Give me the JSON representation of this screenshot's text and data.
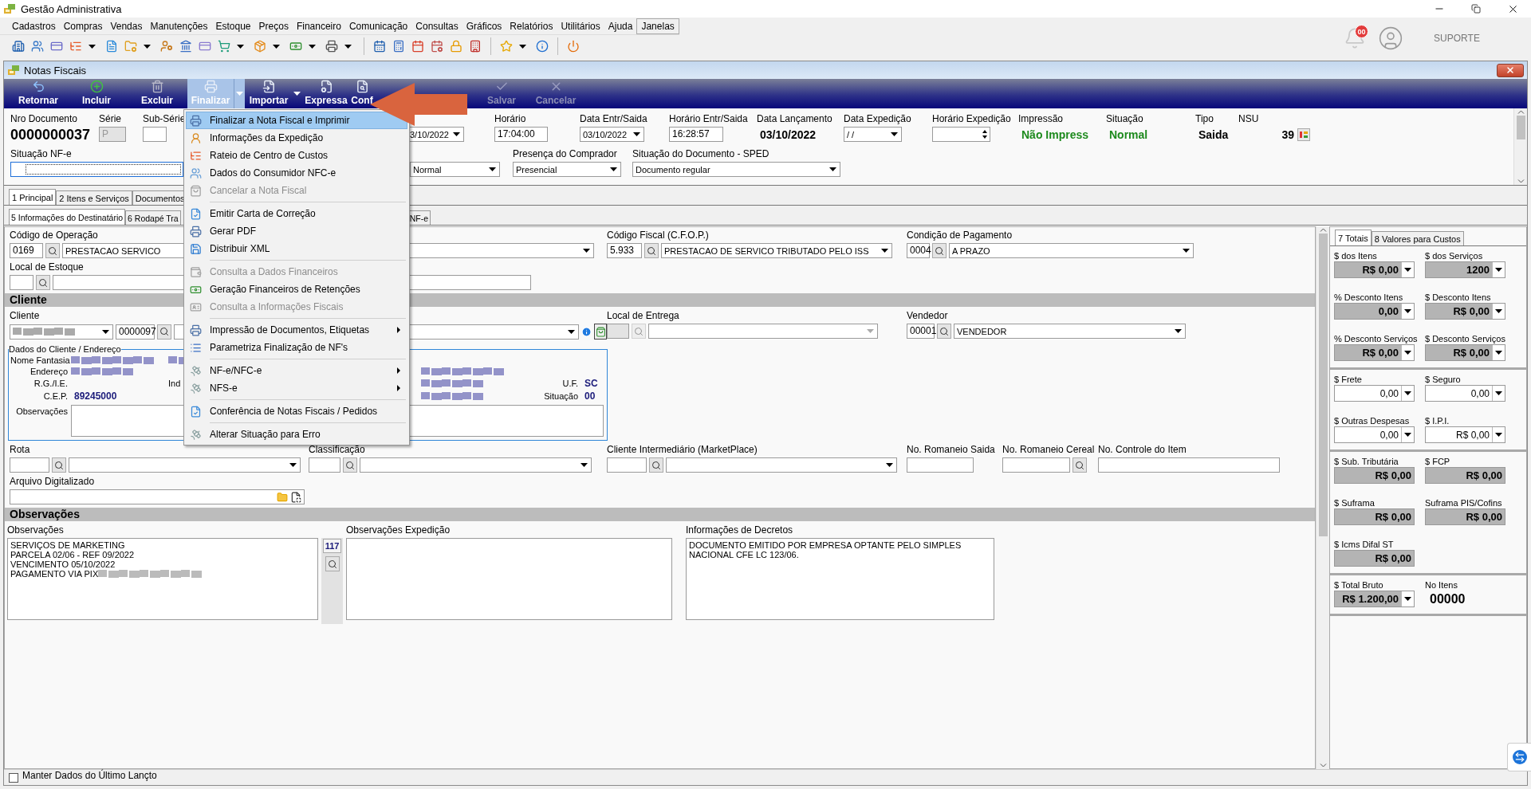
{
  "app": {
    "title": "Gestão Administrativa",
    "menu": [
      {
        "label": "Cadastros",
        "selected": false
      },
      {
        "label": "Compras",
        "selected": false
      },
      {
        "label": "Vendas",
        "selected": false
      },
      {
        "label": "Manutenções",
        "selected": false
      },
      {
        "label": "Estoque",
        "selected": false
      },
      {
        "label": "Preços",
        "selected": false
      },
      {
        "label": "Financeiro",
        "selected": false
      },
      {
        "label": "Comunicação",
        "selected": false
      },
      {
        "label": "Consultas",
        "selected": false
      },
      {
        "label": "Gráficos",
        "selected": false
      },
      {
        "label": "Relatórios",
        "selected": false
      },
      {
        "label": "Utilitários",
        "selected": false
      },
      {
        "label": "Ajuda",
        "selected": false
      },
      {
        "label": "Janelas",
        "selected": true
      }
    ],
    "notifications": "00",
    "user": "SUPORTE"
  },
  "window": {
    "title": "Notas Fiscais",
    "toolbar": [
      {
        "label": "Retornar",
        "disabled": false,
        "pressed": false,
        "dropdown": false
      },
      {
        "label": "Incluir",
        "disabled": false,
        "pressed": false,
        "dropdown": false
      },
      {
        "label": "Excluir",
        "disabled": false,
        "pressed": false,
        "dropdown": false
      },
      {
        "label": "Finalizar",
        "disabled": false,
        "pressed": true,
        "dropdown": true
      },
      {
        "label": "Importar",
        "disabled": false,
        "pressed": false,
        "dropdown": true
      },
      {
        "label": "Expressa",
        "disabled": false,
        "pressed": false,
        "dropdown": false
      },
      {
        "label": "Conf",
        "disabled": false,
        "pressed": false,
        "dropdown": false
      },
      {
        "label": "Salvar",
        "disabled": true,
        "pressed": false,
        "dropdown": false
      },
      {
        "label": "Cancelar",
        "disabled": true,
        "pressed": false,
        "dropdown": false
      }
    ]
  },
  "header": {
    "row_1": [
      {
        "label": "Nro Documento",
        "kind": "big",
        "value": "0000000037"
      },
      {
        "label": "Série",
        "kind": "input",
        "value": "P",
        "disabled": true
      },
      {
        "label": "Sub-Série",
        "kind": "input",
        "disabled": false
      },
      {
        "kind": "combo",
        "value": "3/10/2022"
      },
      {
        "label": "Horário",
        "kind": "input",
        "value": "17:04:00"
      },
      {
        "label": "Data Entr/Saida",
        "kind": "combo",
        "value": "03/10/2022"
      },
      {
        "label": "Horário Entr/Saida",
        "kind": "input",
        "value": "16:28:57"
      },
      {
        "label": "Data Lançamento",
        "kind": "bold",
        "value": "03/10/2022"
      },
      {
        "label": "Data Expedição",
        "kind": "combo",
        "value": "/ /"
      },
      {
        "label": "Horário Expedição",
        "kind": "spin"
      },
      {
        "label": "Impressão",
        "kind": "status",
        "value": "Não Impress"
      },
      {
        "label": "Situação",
        "kind": "status",
        "value": "Normal"
      },
      {
        "label": "Tipo",
        "kind": "bold",
        "value": "Saida"
      },
      {
        "label": "NSU",
        "kind": "counter",
        "value": "39"
      }
    ],
    "row_2": [
      {
        "label": "Situação NF-e",
        "kind": "input",
        "focused": true
      },
      {
        "kind": "combo",
        "value": "Normal"
      },
      {
        "label": "Presença do Comprador",
        "kind": "combo",
        "value": "Presencial"
      },
      {
        "label": "Situação do Documento - SPED",
        "kind": "combo",
        "value": "Documento regular"
      }
    ]
  },
  "tabs": [
    {
      "label": "1 Principal",
      "selected": true
    },
    {
      "label": "2 Itens e Serviços",
      "selected": false
    },
    {
      "label": "Documentos",
      "selected": false
    }
  ],
  "subtabs": [
    {
      "label": "5 Informações do Destinatário",
      "selected": true
    },
    {
      "label": "6 Rodapé Tra",
      "selected": false
    },
    {
      "label": "NF-e",
      "selected": false
    }
  ],
  "form": {
    "operation_row": [
      {
        "label": "Código de Operação",
        "code": "0169",
        "value": "PRESTACAO SERVICO"
      },
      {
        "label": "Código Fiscal (C.F.O.P.)",
        "code": "5.933",
        "value": "PRESTACAO DE SERVICO TRIBUTADO PELO ISS"
      },
      {
        "label": "Condição de Pagamento",
        "code": "0004",
        "value": "A PRAZO"
      }
    ],
    "stock": {
      "label": "Local de Estoque"
    },
    "client_section": "Cliente",
    "client": {
      "label": "Cliente",
      "code": "0000097"
    },
    "delivery": {
      "label": "Local de Entrega",
      "disabled": true
    },
    "seller": {
      "label": "Vendedor",
      "code": "00001",
      "value": "VENDEDOR"
    },
    "address": {
      "title": "Dados do Cliente / Endereço",
      "trade_name_label": "Nome Fantasia",
      "address_label": "Endereço",
      "rg_label": "R.G./I.E.",
      "ind_label": "Ind",
      "cep_label": "C.E.P.",
      "cep": "89245000",
      "uf_label": "U.F.",
      "uf": "SC",
      "status_label": "Situação",
      "status": "00",
      "notes_label": "Observações"
    },
    "route_row": [
      {
        "label": "Rota",
        "kind": "lookup"
      },
      {
        "label": "Classificação",
        "kind": "lookup"
      },
      {
        "label": "Cliente Intermediário (MarketPlace)",
        "kind": "lookup"
      },
      {
        "label": "No. Romaneio Saida",
        "kind": "input"
      },
      {
        "label": "No. Romaneio Cereal",
        "kind": "search-input"
      },
      {
        "label": "No. Controle do Item",
        "kind": "input"
      }
    ],
    "file": {
      "label": "Arquivo Digitalizado"
    },
    "notes_section": "Observações",
    "notes": {
      "label": "Observações",
      "lines": [
        "SERVIÇOS DE MARKETING",
        "PARCELA 02/06 - REF 09/2022",
        "VENCIMENTO 05/10/2022",
        "PAGAMENTO VIA PIX"
      ],
      "count": "117"
    },
    "shipping_notes": {
      "label": "Observações Expedição"
    },
    "decrees": {
      "label": "Informações de Decretos",
      "text": "DOCUMENTO EMITIDO POR EMPRESA OPTANTE PELO SIMPLES NACIONAL CFE LC 123/06."
    }
  },
  "totals": {
    "tabs": [
      {
        "label": "7 Totais",
        "selected": true
      },
      {
        "label": "8 Valores para Custos",
        "selected": false
      }
    ],
    "groups": [
      [
        {
          "label": "$ dos Itens",
          "value": "R$ 0,00",
          "kind": "readonly",
          "dropdown": true
        },
        {
          "label": "$ dos Serviços",
          "value": "1200",
          "kind": "readonly",
          "dropdown": true
        },
        {
          "label": "% Desconto Itens",
          "value": "0,00",
          "kind": "readonly",
          "dropdown": true
        },
        {
          "label": "$ Desconto Itens",
          "value": "R$ 0,00",
          "kind": "readonly",
          "dropdown": true
        },
        {
          "label": "% Desconto Serviços",
          "value": "R$ 0,00",
          "kind": "readonly",
          "dropdown": true
        },
        {
          "label": "$ Desconto Serviços",
          "value": "R$ 0,00",
          "kind": "readonly",
          "dropdown": true
        }
      ],
      [
        {
          "label": "$ Frete",
          "value": "0,00",
          "kind": "editable",
          "dropdown": true
        },
        {
          "label": "$ Seguro",
          "value": "0,00",
          "kind": "editable",
          "dropdown": true
        },
        {
          "label": "$ Outras Despesas",
          "value": "0,00",
          "kind": "editable",
          "dropdown": true
        },
        {
          "label": "$ I.P.I.",
          "value": "R$ 0,00",
          "kind": "editable",
          "dropdown": true
        }
      ],
      [
        {
          "label": "$ Sub. Tributária",
          "value": "R$ 0,00",
          "kind": "readonly",
          "dropdown": false
        },
        {
          "label": "$ FCP",
          "value": "R$ 0,00",
          "kind": "readonly",
          "dropdown": false
        },
        {
          "label": "$ Suframa",
          "value": "R$ 0,00",
          "kind": "readonly",
          "dropdown": false
        },
        {
          "label": "Suframa PIS/Cofins",
          "value": "R$ 0,00",
          "kind": "readonly",
          "dropdown": false
        },
        {
          "label": "$ Icms Difal ST",
          "value": "R$ 0,00",
          "kind": "readonly",
          "dropdown": false
        }
      ],
      [
        {
          "label": "$ Total Bruto",
          "value": "R$ 1.200,00",
          "kind": "readonly",
          "dropdown": true
        },
        {
          "label": "No Itens",
          "value": "00000",
          "kind": "count"
        }
      ]
    ]
  },
  "menu": {
    "groups": [
      [
        {
          "label": "Finalizar a Nota Fiscal e Imprimir",
          "selected": true,
          "disabled": false,
          "submenu": false
        },
        {
          "label": "Informações da Expedição",
          "selected": false,
          "disabled": false,
          "submenu": false
        },
        {
          "label": "Rateio de Centro de Custos",
          "selected": false,
          "disabled": false,
          "submenu": false
        },
        {
          "label": "Dados do Consumidor NFC-e",
          "selected": false,
          "disabled": false,
          "submenu": false
        },
        {
          "label": "Cancelar a Nota Fiscal",
          "selected": false,
          "disabled": true,
          "submenu": false
        }
      ],
      [
        {
          "label": "Emitir Carta de Correção",
          "selected": false,
          "disabled": false,
          "submenu": false
        },
        {
          "label": "Gerar PDF",
          "selected": false,
          "disabled": false,
          "submenu": false
        },
        {
          "label": "Distribuir XML",
          "selected": false,
          "disabled": false,
          "submenu": false
        }
      ],
      [
        {
          "label": "Consulta a Dados Financeiros",
          "selected": false,
          "disabled": true,
          "submenu": false
        },
        {
          "label": "Geração Financeiros de Retenções",
          "selected": false,
          "disabled": false,
          "submenu": false
        },
        {
          "label": "Consulta a Informações Fiscais",
          "selected": false,
          "disabled": true,
          "submenu": false
        }
      ],
      [
        {
          "label": "Impressão de Documentos, Etiquetas",
          "selected": false,
          "disabled": false,
          "submenu": true
        },
        {
          "label": "Parametriza Finalização de NF's",
          "selected": false,
          "disabled": false,
          "submenu": false
        }
      ],
      [
        {
          "label": "NF-e/NFC-e",
          "selected": false,
          "disabled": false,
          "submenu": true
        },
        {
          "label": "NFS-e",
          "selected": false,
          "disabled": false,
          "submenu": true
        }
      ],
      [
        {
          "label": "Conferência de Notas Fiscais / Pedidos",
          "selected": false,
          "disabled": false,
          "submenu": false
        }
      ],
      [
        {
          "label": "Alterar Situação para Erro",
          "selected": false,
          "disabled": false,
          "submenu": false
        }
      ]
    ]
  },
  "status_bar": {
    "label": "Manter Dados do Último Lançto",
    "checked": false
  }
}
